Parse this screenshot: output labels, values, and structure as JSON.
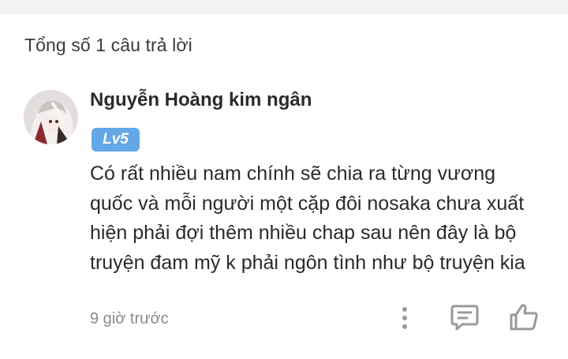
{
  "header": {
    "answer_count_text": "Tổng số 1 câu trả lời"
  },
  "comment": {
    "username": "Nguyễn Hoàng kim ngân",
    "level": "Lv5",
    "lines": [
      "Có rất nhiều nam chính sẽ chia ra từng vương",
      "quốc và mỗi người một cặp đôi nosaka chưa xuất",
      "hiện phải đợi thêm nhiều chap sau nên đây là bộ",
      "truyện đam mỹ k phải ngôn tình như bộ truyện kia"
    ],
    "timestamp": "9 giờ trước"
  },
  "icons": {
    "more": "more-vertical-icon",
    "reply": "comment-reply-icon",
    "like": "thumbs-up-icon"
  },
  "colors": {
    "badge": "#62a7e6",
    "text": "#2a2a2a",
    "muted": "#8a8a8a",
    "icon": "#9a9a9a"
  }
}
